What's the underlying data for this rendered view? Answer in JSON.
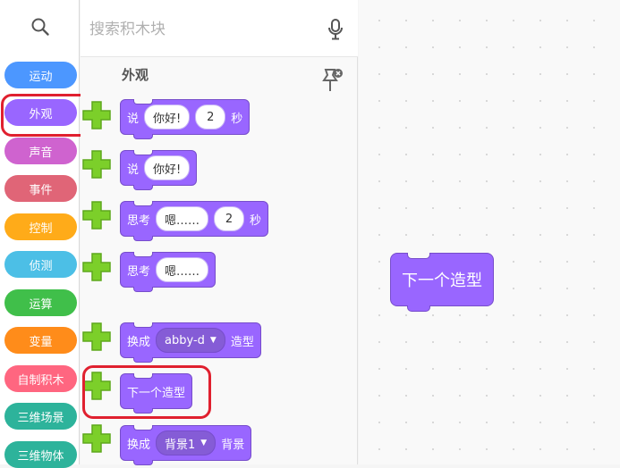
{
  "search": {
    "placeholder": "搜索积木块"
  },
  "categories": [
    {
      "label": "运动",
      "color": "#4c97ff"
    },
    {
      "label": "外观",
      "color": "#9966ff"
    },
    {
      "label": "声音",
      "color": "#cf63cf"
    },
    {
      "label": "事件",
      "color": "#e06577"
    },
    {
      "label": "控制",
      "color": "#ffab19"
    },
    {
      "label": "侦测",
      "color": "#4cbfe6"
    },
    {
      "label": "运算",
      "color": "#40bf4a"
    },
    {
      "label": "变量",
      "color": "#ff8c1a"
    },
    {
      "label": "自制积木",
      "color": "#ff6680"
    },
    {
      "label": "三维场景",
      "color": "#2db39b"
    },
    {
      "label": "三维物体",
      "color": "#2db39b"
    }
  ],
  "selected_category": "外观",
  "palette": {
    "section_title": "外观",
    "blocks": [
      {
        "text1": "说",
        "input": "你好!",
        "num": "2",
        "text2": "秒"
      },
      {
        "text1": "说",
        "input": "你好!"
      },
      {
        "text1": "思考",
        "input": "嗯……",
        "num": "2",
        "text2": "秒"
      },
      {
        "text1": "思考",
        "input": "嗯……"
      },
      {
        "text1": "换成",
        "dropdown": "abby-d",
        "text2": "造型"
      },
      {
        "text1": "下一个造型"
      },
      {
        "text1": "换成",
        "dropdown": "背景1",
        "text2": "背景"
      }
    ]
  },
  "workspace": {
    "block_label": "下一个造型"
  },
  "colors": {
    "looks": "#9966ff",
    "highlight": "#e0202f",
    "plus": "#7ccf2a"
  }
}
